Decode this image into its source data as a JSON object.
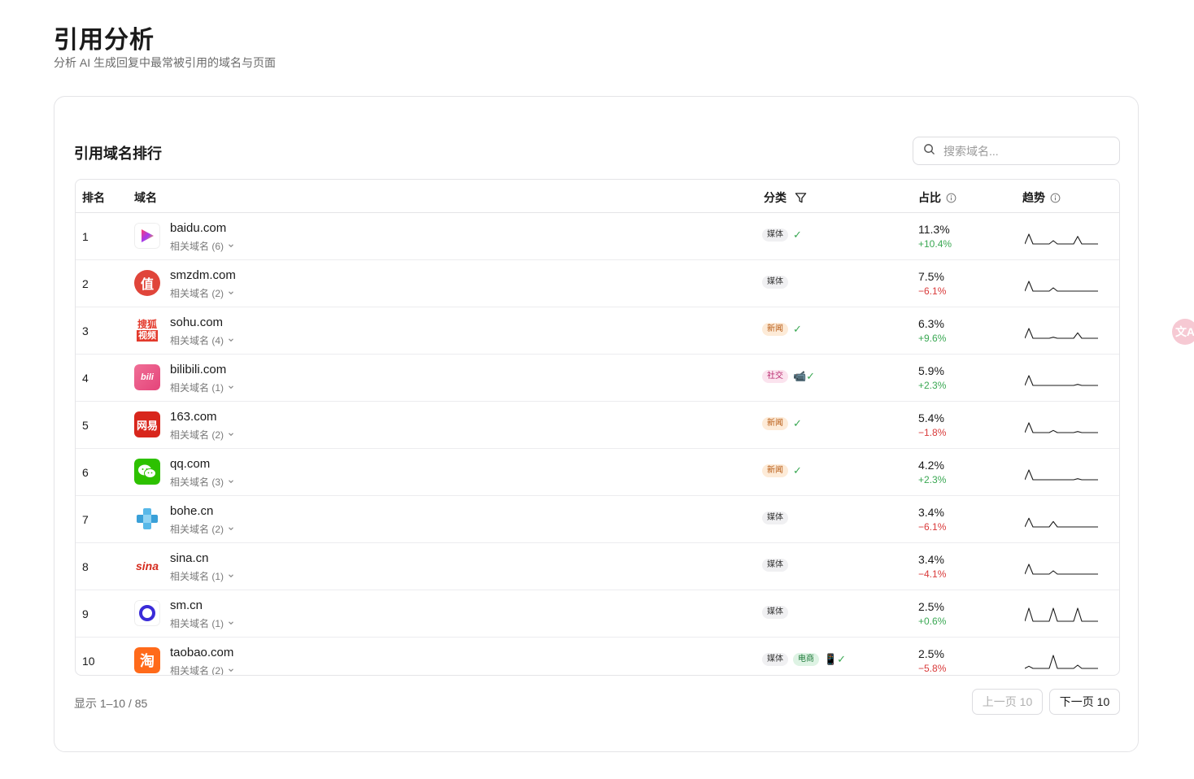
{
  "header": {
    "title": "引用分析",
    "subtitle": "分析 AI 生成回复中最常被引用的域名与页面"
  },
  "card": {
    "title": "引用域名排行",
    "search_placeholder": "搜索域名..."
  },
  "columns": {
    "rank": "排名",
    "domain": "域名",
    "category": "分类",
    "share": "占比",
    "trend": "趋势"
  },
  "rows": [
    {
      "rank": "1",
      "domain": "baidu.com",
      "related": "相关域名 (6)",
      "tags": [
        {
          "label": "媒体",
          "kind": "media"
        }
      ],
      "extra": "✓",
      "share": "11.3%",
      "delta": "+10.4%",
      "delta_dir": "up",
      "logo": "baidu-video-logo",
      "trend": [
        0,
        9,
        0,
        0,
        0,
        0,
        0,
        3,
        0,
        0,
        0,
        0,
        0,
        7,
        0,
        0,
        0,
        0,
        0
      ]
    },
    {
      "rank": "2",
      "domain": "smzdm.com",
      "related": "相关域名 (2)",
      "tags": [
        {
          "label": "媒体",
          "kind": "media"
        }
      ],
      "extra": "",
      "share": "7.5%",
      "delta": "−6.1%",
      "delta_dir": "down",
      "logo": "smzdm-logo",
      "trend": [
        0,
        9,
        0,
        0,
        0,
        0,
        0,
        3,
        0,
        0,
        0,
        0,
        0,
        0,
        0,
        0,
        0,
        0,
        0
      ]
    },
    {
      "rank": "3",
      "domain": "sohu.com",
      "related": "相关域名 (4)",
      "tags": [
        {
          "label": "新闻",
          "kind": "news"
        }
      ],
      "extra": "✓",
      "share": "6.3%",
      "delta": "+9.6%",
      "delta_dir": "up",
      "logo": "sohu-video-logo",
      "trend": [
        0,
        9,
        0,
        0,
        0,
        0,
        0,
        1,
        0,
        0,
        0,
        0,
        0,
        5,
        0,
        0,
        0,
        0,
        0
      ]
    },
    {
      "rank": "4",
      "domain": "bilibili.com",
      "related": "相关域名 (1)",
      "tags": [
        {
          "label": "社交",
          "kind": "social"
        }
      ],
      "extra": "📹✓",
      "share": "5.9%",
      "delta": "+2.3%",
      "delta_dir": "up",
      "logo": "bilibili-logo",
      "trend": [
        0,
        9,
        0,
        0,
        0,
        0,
        0,
        0,
        0,
        0,
        0,
        0,
        0,
        1,
        0,
        0,
        0,
        0,
        0
      ]
    },
    {
      "rank": "5",
      "domain": "163.com",
      "related": "相关域名 (2)",
      "tags": [
        {
          "label": "新闻",
          "kind": "news"
        }
      ],
      "extra": "✓",
      "share": "5.4%",
      "delta": "−1.8%",
      "delta_dir": "down",
      "logo": "netease-logo",
      "trend": [
        0,
        9,
        0,
        0,
        0,
        0,
        0,
        2,
        0,
        0,
        0,
        0,
        0,
        1,
        0,
        0,
        0,
        0,
        0
      ]
    },
    {
      "rank": "6",
      "domain": "qq.com",
      "related": "相关域名 (3)",
      "tags": [
        {
          "label": "新闻",
          "kind": "news"
        }
      ],
      "extra": "✓",
      "share": "4.2%",
      "delta": "+2.3%",
      "delta_dir": "up",
      "logo": "wechat-logo",
      "trend": [
        0,
        9,
        0,
        0,
        0,
        0,
        0,
        0,
        0,
        0,
        0,
        0,
        0,
        1,
        0,
        0,
        0,
        0,
        0
      ]
    },
    {
      "rank": "7",
      "domain": "bohe.cn",
      "related": "相关域名 (2)",
      "tags": [
        {
          "label": "媒体",
          "kind": "media"
        }
      ],
      "extra": "",
      "share": "3.4%",
      "delta": "−6.1%",
      "delta_dir": "down",
      "logo": "bohe-logo",
      "trend": [
        0,
        8,
        0,
        0,
        0,
        0,
        0,
        5,
        0,
        0,
        0,
        0,
        0,
        0,
        0,
        0,
        0,
        0,
        0
      ]
    },
    {
      "rank": "8",
      "domain": "sina.cn",
      "related": "相关域名 (1)",
      "tags": [
        {
          "label": "媒体",
          "kind": "media"
        }
      ],
      "extra": "",
      "share": "3.4%",
      "delta": "−4.1%",
      "delta_dir": "down",
      "logo": "sina-logo",
      "trend": [
        0,
        9,
        0,
        0,
        0,
        0,
        0,
        3,
        0,
        0,
        0,
        0,
        0,
        0,
        0,
        0,
        0,
        0,
        0
      ]
    },
    {
      "rank": "9",
      "domain": "sm.cn",
      "related": "相关域名 (1)",
      "tags": [
        {
          "label": "媒体",
          "kind": "media"
        }
      ],
      "extra": "",
      "share": "2.5%",
      "delta": "+0.6%",
      "delta_dir": "up",
      "logo": "sm-logo",
      "trend": [
        0,
        12,
        0,
        0,
        0,
        0,
        0,
        12,
        0,
        0,
        0,
        0,
        0,
        12,
        0,
        0,
        0,
        0,
        0
      ]
    },
    {
      "rank": "10",
      "domain": "taobao.com",
      "related": "相关域名 (2)",
      "tags": [
        {
          "label": "媒体",
          "kind": "media"
        },
        {
          "label": "电商",
          "kind": "ecom"
        }
      ],
      "extra": "📱✓",
      "share": "2.5%",
      "delta": "−5.8%",
      "delta_dir": "down",
      "logo": "taobao-logo",
      "trend": [
        0,
        2,
        0,
        0,
        0,
        0,
        0,
        12,
        0,
        0,
        0,
        0,
        0,
        3,
        0,
        0,
        0,
        0,
        0
      ]
    }
  ],
  "footer": {
    "showing": "显示 1–10 / 85",
    "prev_label": "上一页 10",
    "next_label": "下一页 10"
  },
  "floating": {
    "label": "文A"
  },
  "colors": {
    "positive": "#3aa853",
    "negative": "#d93a3a",
    "border": "#e4e4e7"
  }
}
